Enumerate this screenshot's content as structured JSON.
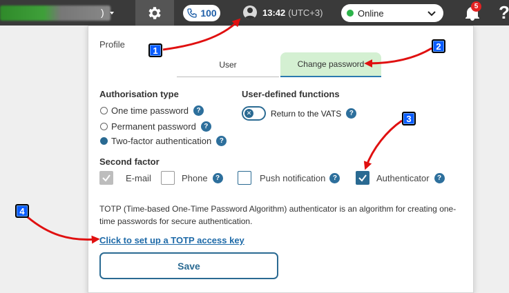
{
  "topbar": {
    "calls_count": "100",
    "time": "13:42",
    "timezone": "(UTC+3)",
    "status": "Online",
    "notifications": "5",
    "help": "?"
  },
  "panel": {
    "title": "Profile",
    "tabs": [
      {
        "label": "User",
        "active": false
      },
      {
        "label": "Change password",
        "active": true
      }
    ],
    "auth_type": {
      "title": "Authorisation type",
      "options": [
        {
          "label": "One time password",
          "selected": false
        },
        {
          "label": "Permanent password",
          "selected": false
        },
        {
          "label": "Two-factor authentication",
          "selected": true
        }
      ]
    },
    "user_functions": {
      "title": "User-defined functions",
      "toggle_label": "Return to the VATS",
      "toggle_on": false
    },
    "second_factor": {
      "title": "Second factor",
      "options": [
        {
          "label": "E-mail",
          "checked": true,
          "disabled": true
        },
        {
          "label": "Phone",
          "checked": false
        },
        {
          "label": "Push notification",
          "checked": false
        },
        {
          "label": "Authenticator",
          "checked": true
        }
      ]
    },
    "description": "TOTP (Time-based One-Time Password Algorithm) authenticator is an algorithm for creating one-time passwords for secure authentication.",
    "link_text": "Click to set up a TOTP access key",
    "save_label": "Save",
    "help_glyph": "?"
  },
  "callouts": [
    "1",
    "2",
    "3",
    "4"
  ],
  "colors": {
    "accent": "#2a6a92",
    "online": "#2cb34a",
    "callout": "#0a5cff",
    "arrow": "#e01010"
  }
}
